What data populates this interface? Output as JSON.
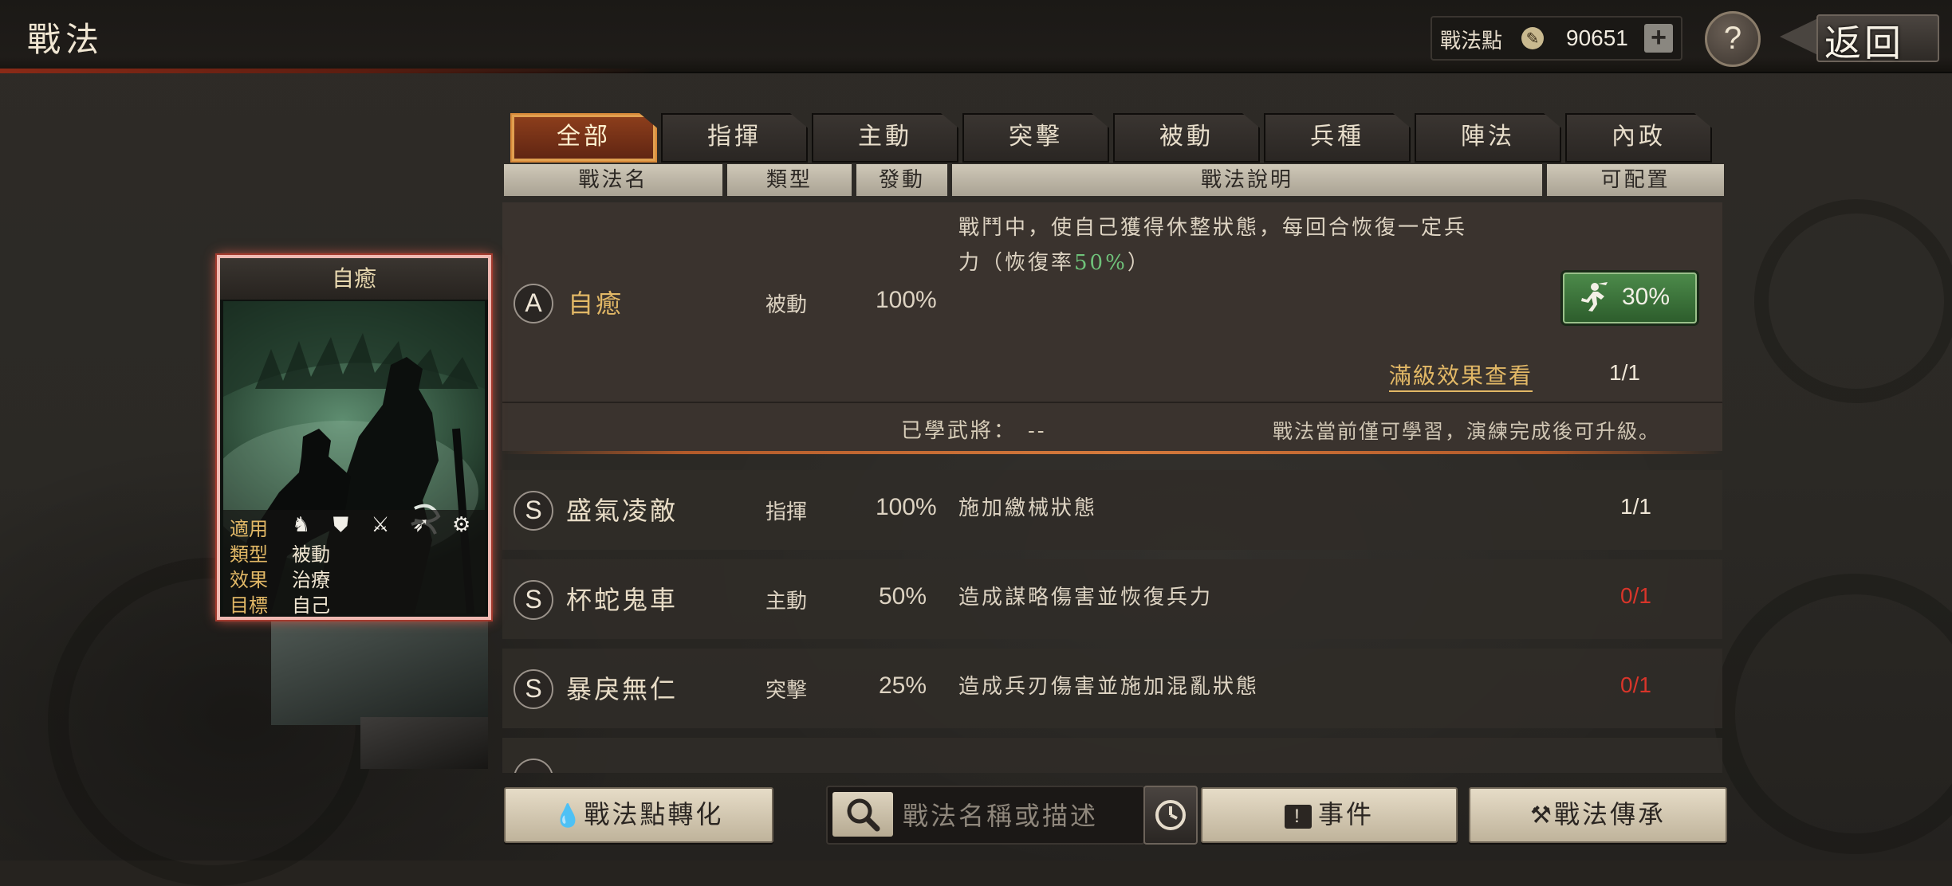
{
  "header": {
    "title": "戰法",
    "points_label": "戰法點",
    "points_value": "90651",
    "plus": "+",
    "help": "?",
    "back_label": "返回"
  },
  "tabs": [
    {
      "label": "全部",
      "active": true
    },
    {
      "label": "指揮",
      "active": false
    },
    {
      "label": "主動",
      "active": false
    },
    {
      "label": "突擊",
      "active": false
    },
    {
      "label": "被動",
      "active": false
    },
    {
      "label": "兵種",
      "active": false
    },
    {
      "label": "陣法",
      "active": false
    },
    {
      "label": "內政",
      "active": false
    }
  ],
  "columns": {
    "name": "戰法名",
    "type": "類型",
    "trigger": "發動",
    "desc": "戰法說明",
    "available": "可配置"
  },
  "card": {
    "title": "自癒",
    "apply_label": "適用",
    "type_label": "類型",
    "type_value": "被動",
    "effect_label": "效果",
    "effect_value": "治療",
    "target_label": "目標",
    "target_value": "自己",
    "unit_icons": "♞ ⛊ ⚔ ➶ ⚙"
  },
  "selected": {
    "grade": "A",
    "name": "自癒",
    "type": "被動",
    "rate": "100%",
    "desc_line1": "戰鬥中，使自己獲得休整狀態，每回合恢復一定兵",
    "desc_line2_prefix": "力（恢復率",
    "desc_line2_value": "50%",
    "desc_line2_suffix": "）",
    "bonus_value": "30%",
    "full_effect_link": "滿級效果查看",
    "available": "1/1",
    "learned_label": "已學武將：",
    "learned_value": "--",
    "note": "戰法當前僅可學習，演練完成後可升級。"
  },
  "rows": [
    {
      "grade": "S",
      "name": "盛氣凌敵",
      "type": "指揮",
      "rate": "100%",
      "desc": "施加繳械狀態",
      "available": "1/1",
      "available_red": false
    },
    {
      "grade": "S",
      "name": "杯蛇鬼車",
      "type": "主動",
      "rate": "50%",
      "desc": "造成謀略傷害並恢復兵力",
      "available": "0/1",
      "available_red": true
    },
    {
      "grade": "S",
      "name": "暴戾無仁",
      "type": "突擊",
      "rate": "25%",
      "desc": "造成兵刃傷害並施加混亂狀態",
      "available": "0/1",
      "available_red": true
    }
  ],
  "bottom": {
    "convert_label": "戰法點轉化",
    "search_placeholder": "戰法名稱或描述",
    "event_label": "事件",
    "inherit_label": "戰法傳承"
  },
  "colors": {
    "accent_orange": "#d98a3a",
    "highlight_gold": "#e2b866",
    "bonus_green": "#4c8a4a",
    "unavailable_red": "#d8352a"
  }
}
